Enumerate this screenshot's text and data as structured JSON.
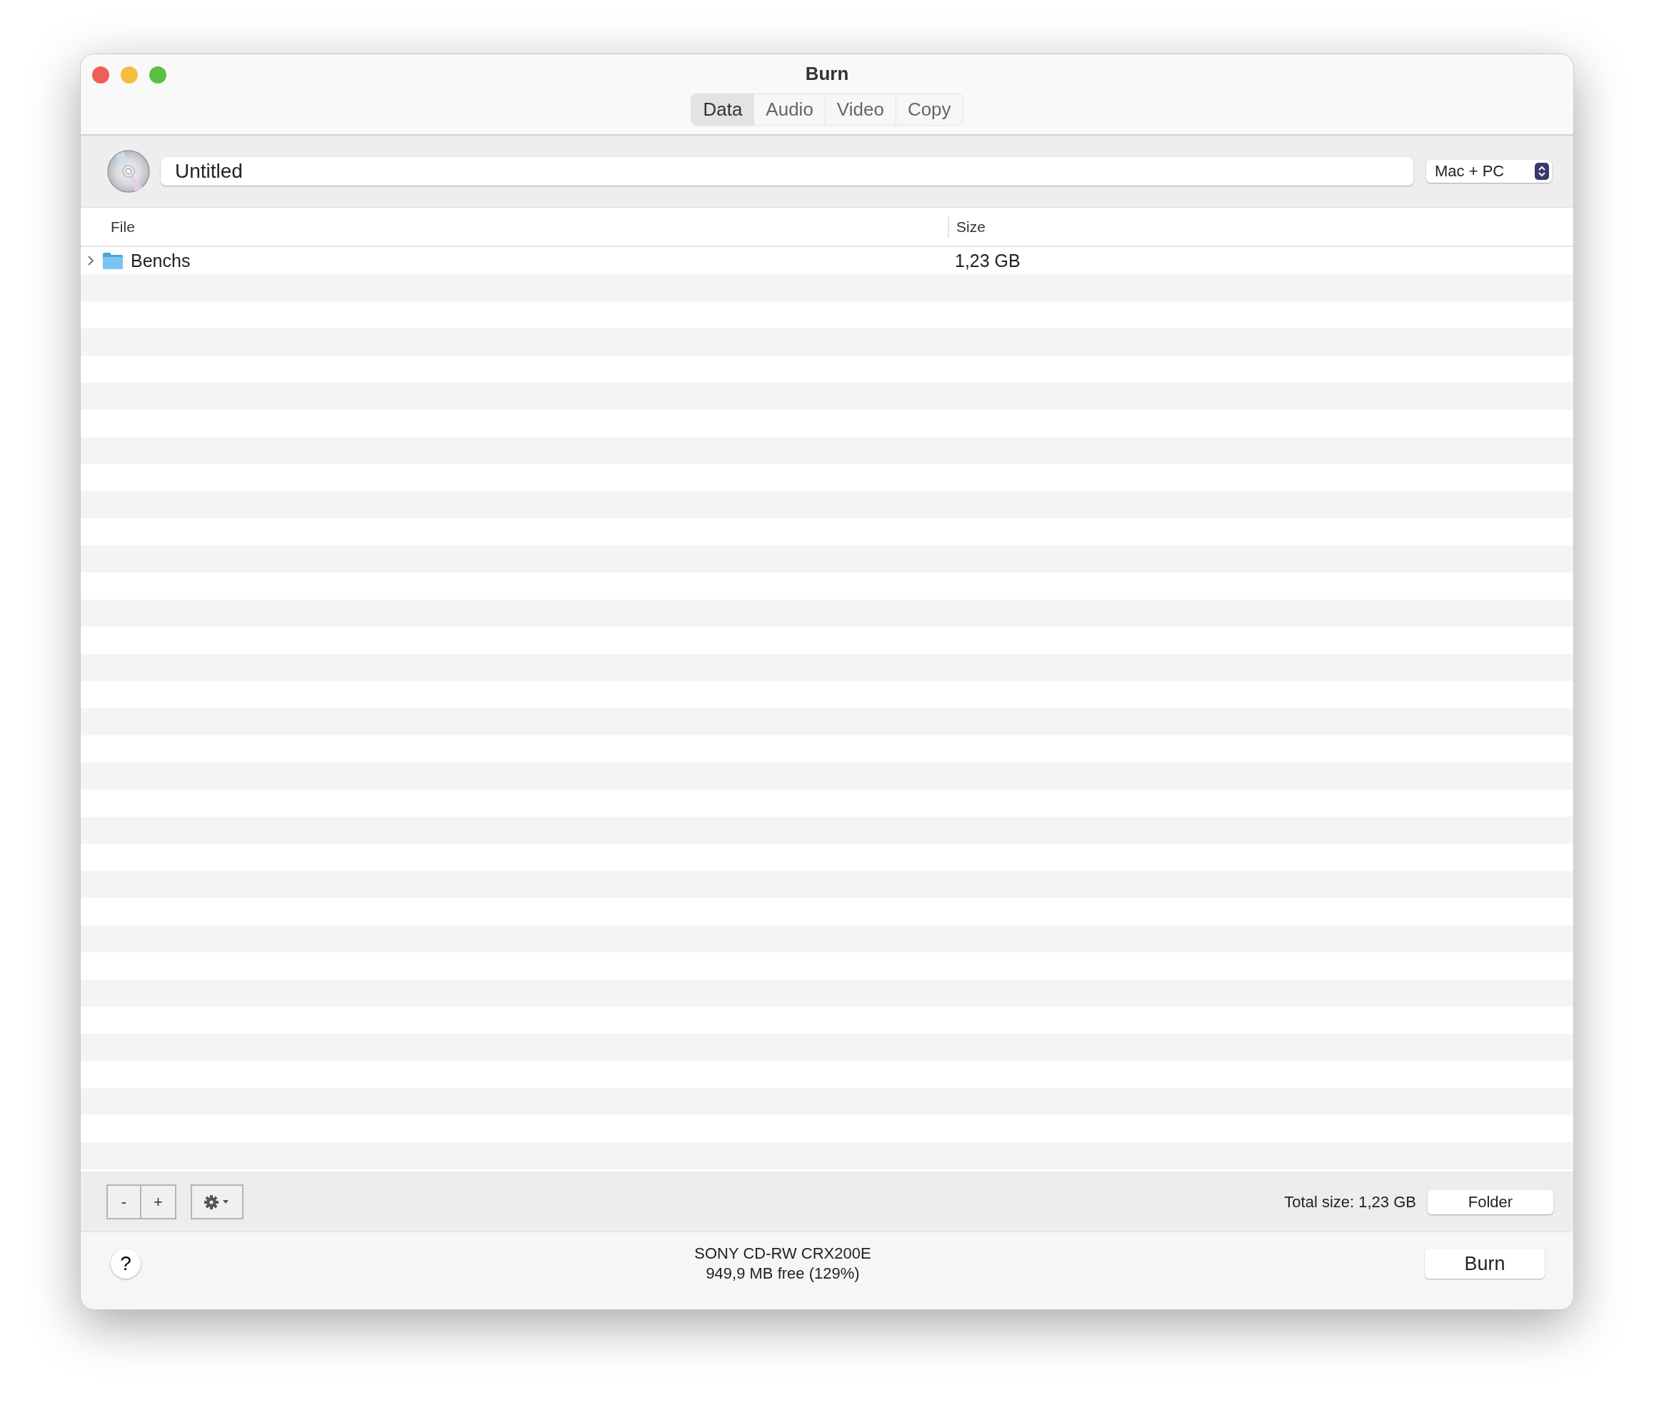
{
  "window": {
    "title": "Burn"
  },
  "tabs": [
    {
      "label": "Data",
      "selected": true
    },
    {
      "label": "Audio",
      "selected": false
    },
    {
      "label": "Video",
      "selected": false
    },
    {
      "label": "Copy",
      "selected": false
    }
  ],
  "disc_name": {
    "value": "Untitled"
  },
  "format_popup": {
    "value": "Mac + PC"
  },
  "table": {
    "columns": [
      "File",
      "Size"
    ],
    "rows": [
      {
        "name": "Benchs",
        "size": "1,23 GB",
        "expanded": false
      }
    ]
  },
  "edit_buttons": [
    "-",
    "+"
  ],
  "total_size": "Total size: 1,23 GB",
  "folder_button": "Folder",
  "help_button": "?",
  "drive": {
    "name": "SONY CD-RW CRX200E",
    "free": "949,9 MB free (129%)"
  },
  "burn_button": "Burn"
}
